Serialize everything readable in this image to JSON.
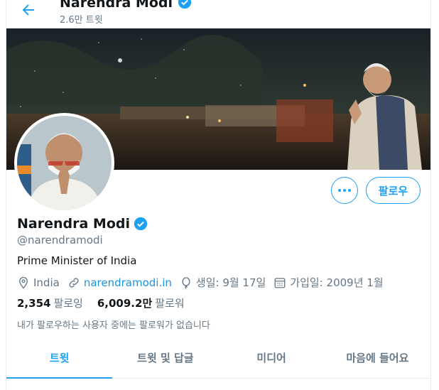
{
  "header": {
    "title": "Narendra Modi",
    "tweet_count": "2.6만 트윗"
  },
  "profile": {
    "name": "Narendra Modi",
    "handle": "@narendramodi",
    "bio": "Prime Minister of India",
    "location": "India",
    "website": "narendramodi.in",
    "birthday": "생일: 9월 17일",
    "joined": "가입일: 2009년 1월",
    "following_count": "2,354",
    "following_label": "팔로잉",
    "followers_count": "6,009.2만",
    "followers_label": "팔로워",
    "follow_note": "내가 팔로우하는 사용자 중에는 팔로워가 없습니다"
  },
  "actions": {
    "follow_label": "팔로우"
  },
  "tabs": [
    {
      "label": "트윗"
    },
    {
      "label": "트윗 및 답글"
    },
    {
      "label": "미디어"
    },
    {
      "label": "마음에 들어요"
    }
  ],
  "colors": {
    "accent": "#1da1f2",
    "muted": "#657786",
    "verified": "#1da1f2"
  },
  "icons": [
    "back-arrow-icon",
    "verified-badge-icon",
    "more-icon",
    "location-pin-icon",
    "link-icon",
    "balloon-icon",
    "calendar-icon"
  ]
}
